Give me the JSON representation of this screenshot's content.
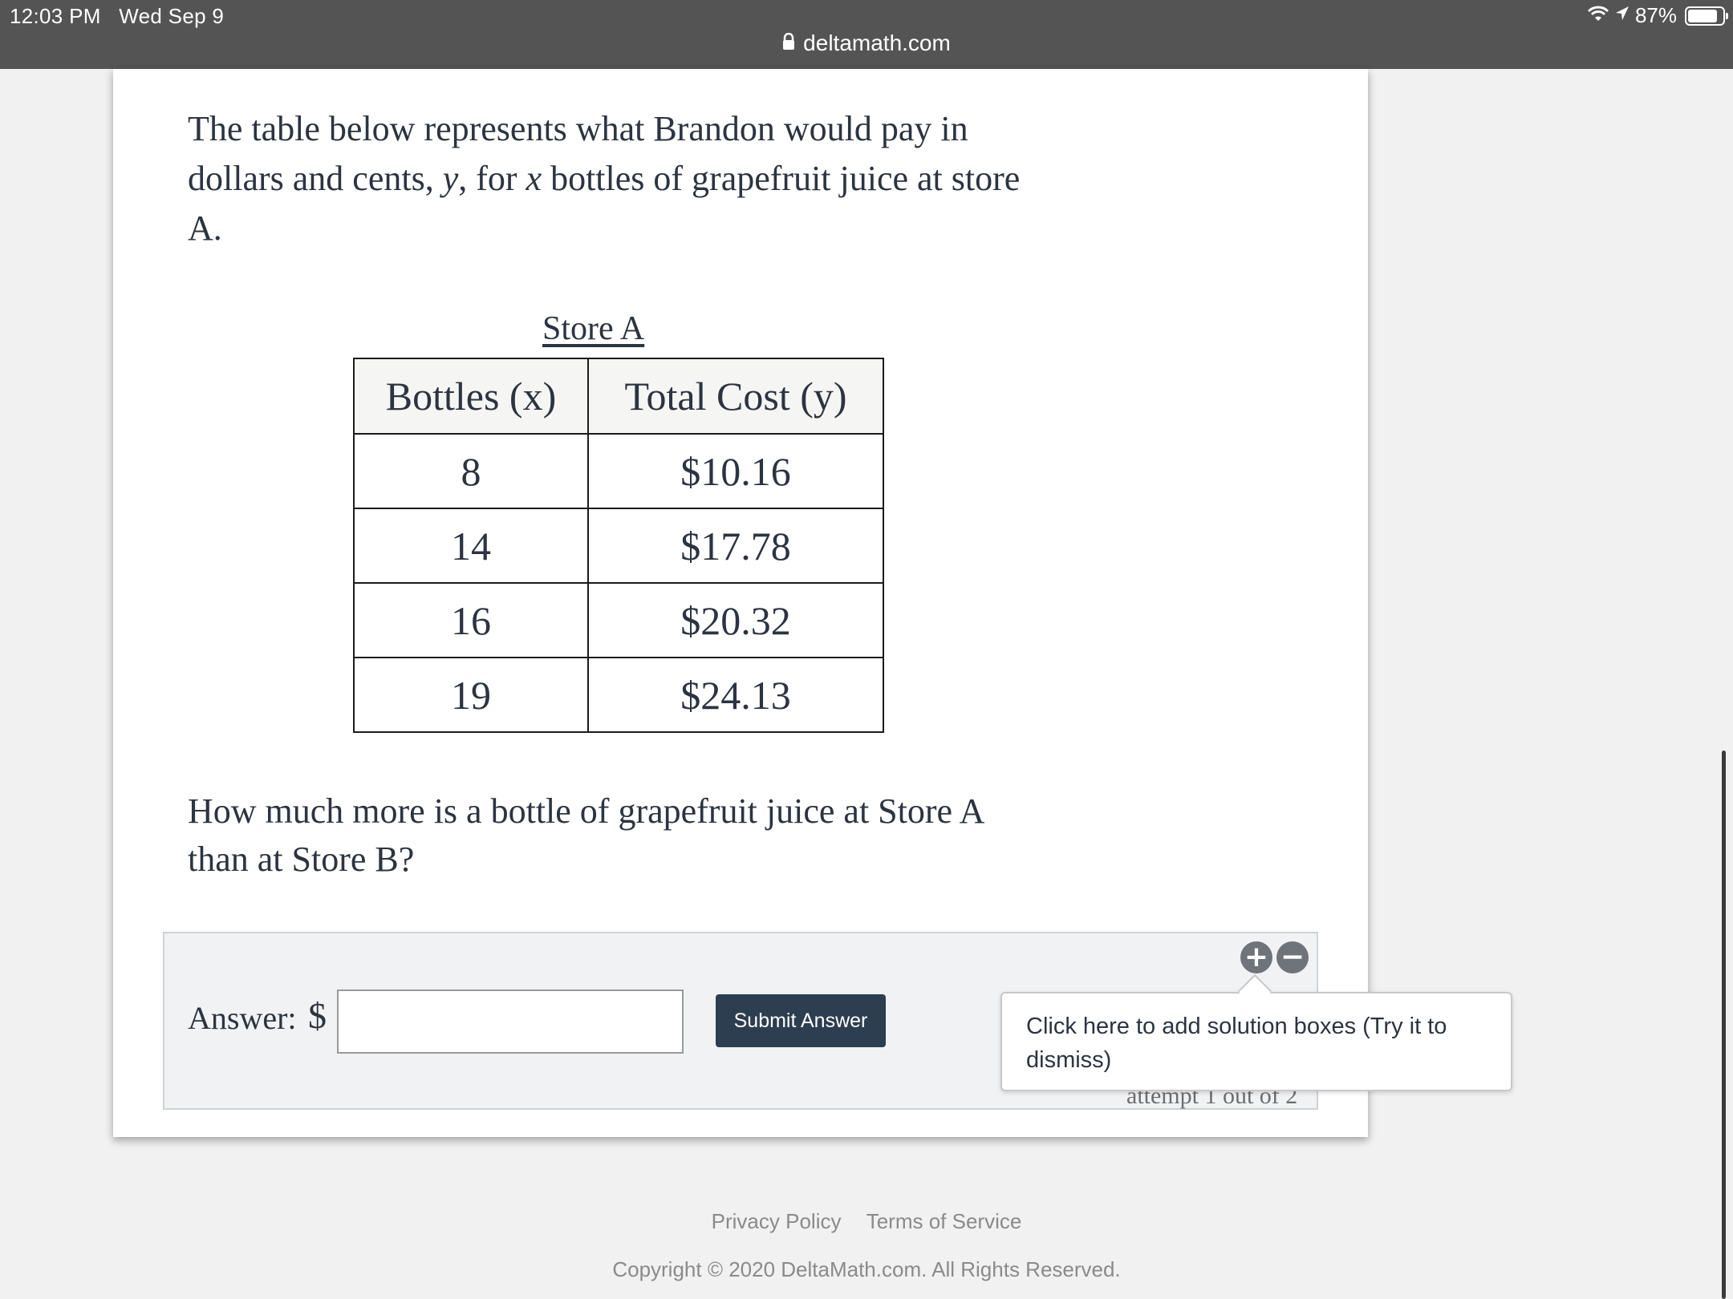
{
  "status_bar": {
    "time": "12:03 PM",
    "date": "Wed Sep 9",
    "battery": "87%",
    "battery_level": 0.87
  },
  "browser": {
    "url": "deltamath.com"
  },
  "problem": {
    "text_before_y": "The table below represents what Brandon would pay in dollars and cents, ",
    "var_y": "y",
    "text_for": ", for ",
    "var_x": "x",
    "text_after_x": " bottles of grapefruit juice at store A."
  },
  "table": {
    "title": "Store A",
    "header_col1": "Bottles (x)",
    "header_col2": "Total Cost (y)",
    "rows": [
      {
        "bottles": "8",
        "cost": "$10.16"
      },
      {
        "bottles": "14",
        "cost": "$17.78"
      },
      {
        "bottles": "16",
        "cost": "$20.32"
      },
      {
        "bottles": "19",
        "cost": "$24.13"
      }
    ]
  },
  "question": {
    "text": "How much more is a bottle of grapefruit juice at Store A than at Store B?"
  },
  "answer": {
    "label": "Answer:",
    "currency_symbol": "$",
    "input_value": "",
    "submit_label": "Submit Answer",
    "plus_icon": "plus-circle-icon",
    "minus_icon": "minus-circle-icon",
    "attempt_text": "attempt 1 out of 2"
  },
  "tooltip": {
    "text": "Click here to add solution boxes (Try it to dismiss)"
  },
  "footer": {
    "privacy_policy": "Privacy Policy",
    "terms_of_service": "Terms of Service",
    "copyright": "Copyright © 2020 DeltaMath.com. All Rights Reserved."
  },
  "colors": {
    "status_bar_bg": "#545454",
    "submit_button_bg": "#2c3e50",
    "text_color": "#2b3440"
  }
}
